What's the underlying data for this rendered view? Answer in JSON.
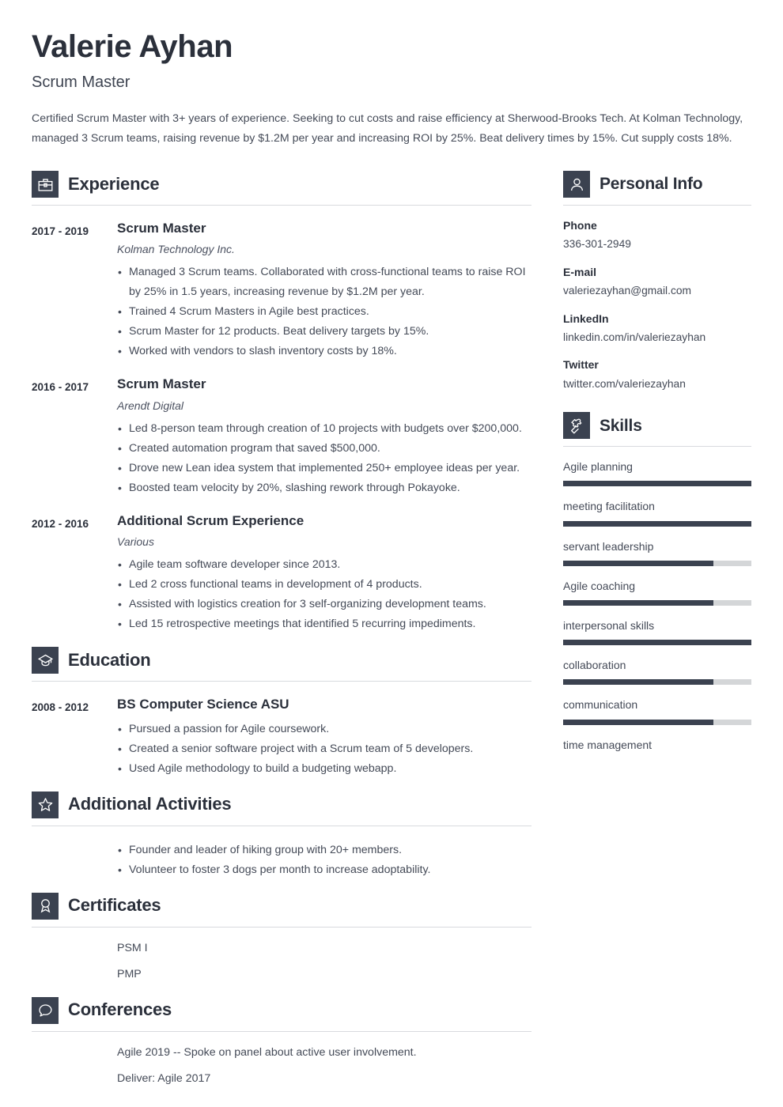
{
  "header": {
    "name": "Valerie Ayhan",
    "job_title": "Scrum Master",
    "summary": "Certified Scrum Master with 3+ years of experience. Seeking to cut costs and raise efficiency at Sherwood-Brooks Tech. At Kolman Technology, managed 3 Scrum teams, raising revenue by $1.2M per year and increasing ROI by 25%. Beat delivery times by 15%. Cut supply costs 18%."
  },
  "theme": {
    "accent": "#3b4250",
    "heading": "#2b303b",
    "body_text": "#444a57",
    "rule": "#d8dade",
    "skill_track": "#d4d6d8"
  },
  "sections": {
    "experience": {
      "title": "Experience",
      "icon": "briefcase-icon",
      "entries": [
        {
          "dates": "2017 - 2019",
          "role": "Scrum Master",
          "org": "Kolman Technology Inc.",
          "bullets": [
            "Managed 3 Scrum teams. Collaborated with cross-functional teams to raise ROI by 25% in 1.5 years, increasing revenue by $1.2M per year.",
            "Trained 4 Scrum Masters in Agile best practices.",
            "Scrum Master for 12 products. Beat delivery targets by 15%.",
            "Worked with vendors to slash inventory costs by 18%."
          ]
        },
        {
          "dates": "2016 - 2017",
          "role": "Scrum Master",
          "org": "Arendt Digital",
          "bullets": [
            "Led 8-person team through creation of 10 projects with budgets over $200,000.",
            "Created automation program that saved $500,000.",
            "Drove new Lean idea system that implemented 250+ employee ideas per year.",
            "Boosted team velocity by 20%, slashing rework through Pokayoke."
          ]
        },
        {
          "dates": "2012 - 2016",
          "role": "Additional Scrum Experience",
          "org": "Various",
          "bullets": [
            "Agile team software developer since 2013.",
            "Led 2 cross functional teams in development of 4 products.",
            "Assisted with logistics creation for 3 self-organizing development teams.",
            "Led 15 retrospective meetings that identified 5 recurring impediments."
          ]
        }
      ]
    },
    "education": {
      "title": "Education",
      "icon": "graduation-cap-icon",
      "entries": [
        {
          "dates": "2008 - 2012",
          "role": "BS Computer Science ASU",
          "bullets": [
            "Pursued a passion for Agile coursework.",
            "Created a senior software project with a Scrum team of 5 developers.",
            "Used Agile methodology to build a budgeting webapp."
          ]
        }
      ]
    },
    "additional_activities": {
      "title": "Additional Activities",
      "icon": "star-icon",
      "bullets": [
        "Founder and leader of hiking group with 20+ members.",
        "Volunteer to foster 3 dogs per month to increase adoptability."
      ]
    },
    "certificates": {
      "title": "Certificates",
      "icon": "award-ribbon-icon",
      "items": [
        "PSM I",
        "PMP"
      ]
    },
    "conferences": {
      "title": "Conferences",
      "icon": "speech-bubble-icon",
      "items": [
        "Agile 2019 -- Spoke on panel about active user involvement.",
        "Deliver: Agile 2017"
      ]
    },
    "personal_info": {
      "title": "Personal Info",
      "icon": "person-icon",
      "fields": [
        {
          "label": "Phone",
          "value": "336-301-2949"
        },
        {
          "label": "E-mail",
          "value": "valeriezayhan@gmail.com"
        },
        {
          "label": "LinkedIn",
          "value": "linkedin.com/in/valeriezayhan"
        },
        {
          "label": "Twitter",
          "value": "twitter.com/valeriezayhan"
        }
      ]
    },
    "skills": {
      "title": "Skills",
      "icon": "puzzle-piece-icon",
      "items": [
        {
          "name": "Agile planning",
          "level": 100,
          "has_bar": true
        },
        {
          "name": "meeting facilitation",
          "level": 100,
          "has_bar": true
        },
        {
          "name": "servant leadership",
          "level": 80,
          "has_bar": true
        },
        {
          "name": "Agile coaching",
          "level": 80,
          "has_bar": true
        },
        {
          "name": "interpersonal skills",
          "level": 100,
          "has_bar": true
        },
        {
          "name": "collaboration",
          "level": 80,
          "has_bar": true
        },
        {
          "name": "communication",
          "level": 80,
          "has_bar": true
        },
        {
          "name": "time management",
          "level": 0,
          "has_bar": false
        }
      ]
    }
  }
}
